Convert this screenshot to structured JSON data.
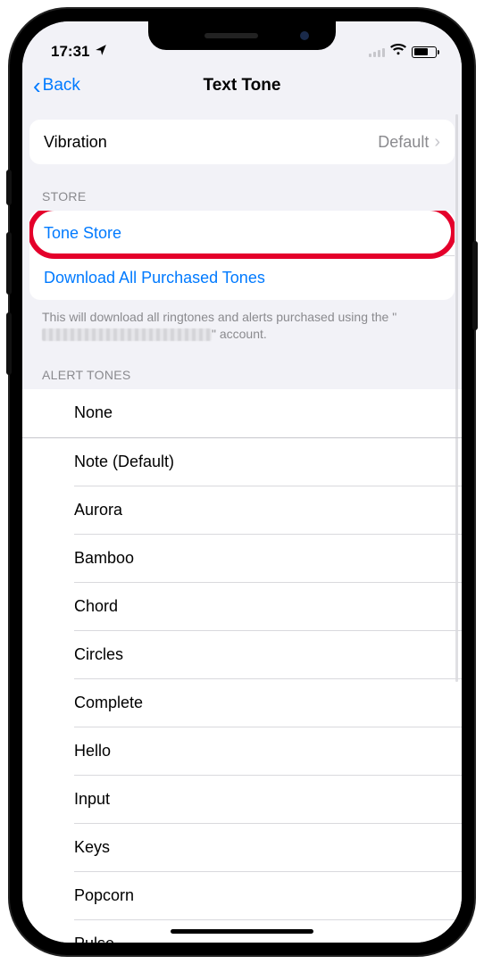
{
  "status": {
    "time": "17:31"
  },
  "nav": {
    "back_label": "Back",
    "title": "Text Tone"
  },
  "vibration": {
    "label": "Vibration",
    "value": "Default"
  },
  "store": {
    "header": "STORE",
    "tone_store": "Tone Store",
    "download_all": "Download All Purchased Tones",
    "footer_prefix": "This will download all ringtones and alerts purchased using the \"",
    "footer_suffix": "\" account."
  },
  "alert": {
    "header": "ALERT TONES",
    "tones": [
      "None",
      "Note (Default)",
      "Aurora",
      "Bamboo",
      "Chord",
      "Circles",
      "Complete",
      "Hello",
      "Input",
      "Keys",
      "Popcorn",
      "Pulse"
    ]
  }
}
